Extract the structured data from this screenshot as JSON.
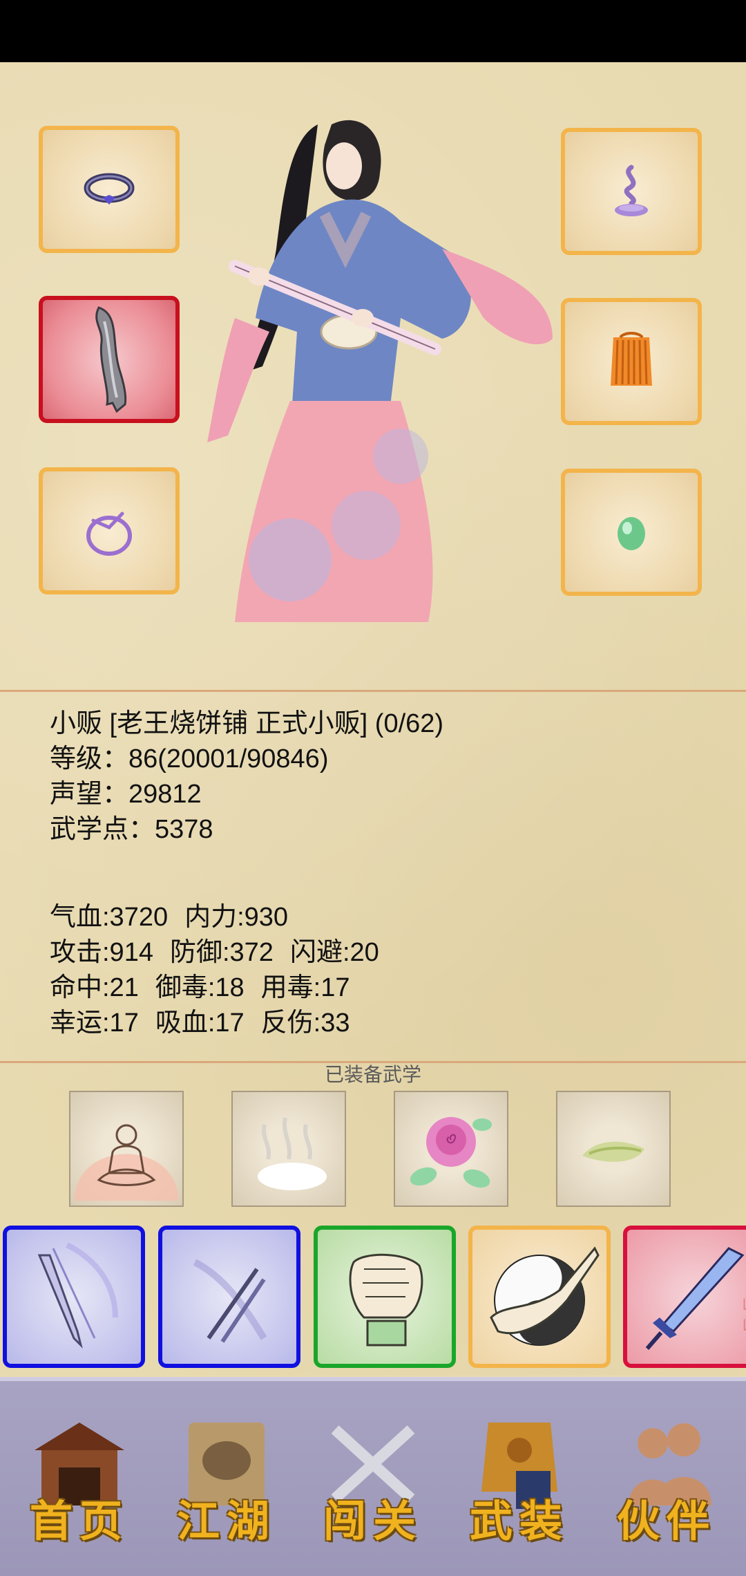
{
  "profile": {
    "title_line": "小贩 [老王烧饼铺 正式小贩] (0/62)",
    "level": "等级：86(20001/90846)",
    "reputation": "声望：29812",
    "martial_points": "武学点：5378"
  },
  "attributes": {
    "row1": [
      "气血:3720",
      "内力:930"
    ],
    "row2": [
      "攻击:914",
      "防御:372",
      "闪避:20"
    ],
    "row3": [
      "命中:21",
      "御毒:18",
      "用毒:17"
    ],
    "row4": [
      "幸运:17",
      "吸血:17",
      "反伤:33"
    ]
  },
  "equipped_martial_title": "已装备武学",
  "equipment_slots": [
    {
      "icon": "ring-icon"
    },
    {
      "icon": "incense-icon"
    },
    {
      "icon": "blade-icon",
      "selected": true
    },
    {
      "icon": "armor-icon"
    },
    {
      "icon": "bracelet-icon"
    },
    {
      "icon": "jade-icon"
    }
  ],
  "martial_arts": [
    {
      "icon": "meditation-icon"
    },
    {
      "icon": "mist-icon"
    },
    {
      "icon": "rose-icon"
    },
    {
      "icon": "herb-icon"
    }
  ],
  "skills": [
    {
      "icon": "sword-slash-icon",
      "rarity": "blue"
    },
    {
      "icon": "twin-blades-icon",
      "rarity": "blue"
    },
    {
      "icon": "fist-icon",
      "rarity": "green"
    },
    {
      "icon": "yin-yang-palm-icon",
      "rarity": "orange"
    },
    {
      "icon": "blue-sword-icon",
      "rarity": "red",
      "watermark": "峨嵋"
    }
  ],
  "nav": {
    "home": "首页",
    "jianghu": "江湖",
    "challenge": "闯关",
    "equipment": "武装",
    "partner": "伙伴"
  },
  "colors": {
    "slot_border": "#f3b44a",
    "selected_border": "#c8101e",
    "blue_rarity": "#1010e0",
    "green_rarity": "#19a62a",
    "red_rarity": "#d8103c",
    "nav_text": "#f0b21e"
  }
}
